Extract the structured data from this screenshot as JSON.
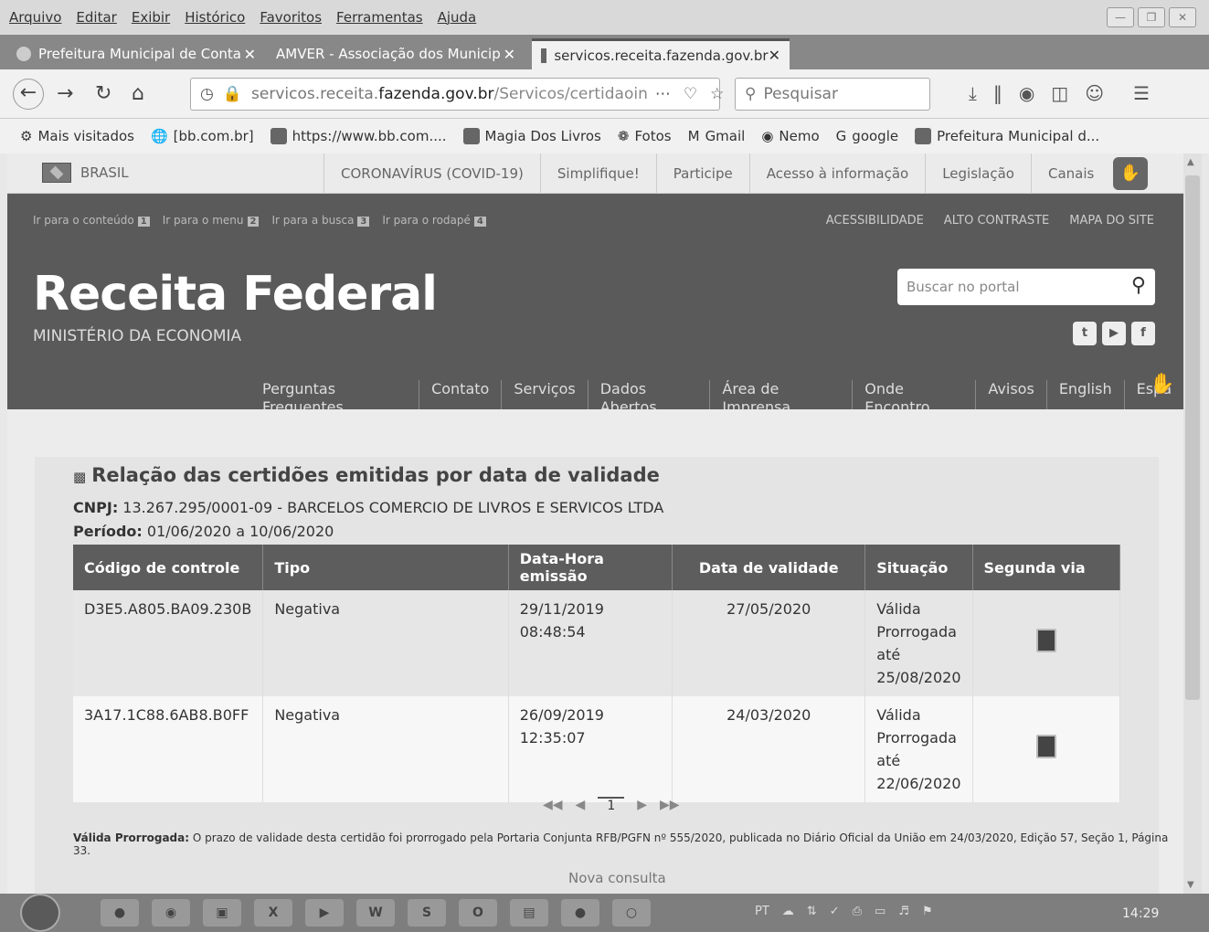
{
  "menubar": {
    "items": [
      "Arquivo",
      "Editar",
      "Exibir",
      "Histórico",
      "Favoritos",
      "Ferramentas",
      "Ajuda"
    ]
  },
  "tabs": [
    {
      "label": "Prefeitura Municipal de Conta",
      "active": false
    },
    {
      "label": "AMVER - Associação dos Municip",
      "active": false
    },
    {
      "label": "servicos.receita.fazenda.gov.br",
      "active": true
    }
  ],
  "url": {
    "prefix": "servicos.receita.",
    "domain": "fazenda.gov.br",
    "path": "/Servicos/certidaoin"
  },
  "search": {
    "placeholder": "Pesquisar"
  },
  "bookmarks": [
    "Mais visitados",
    "[bb.com.br]",
    "https://www.bb.com....",
    "Magia Dos Livros",
    "Fotos",
    "Gmail",
    "Nemo",
    "google",
    "Prefeitura Municipal d..."
  ],
  "govbar": {
    "brasil": "BRASIL",
    "links": [
      "CORONAVÍRUS (COVID-19)",
      "Simplifique!",
      "Participe",
      "Acesso à informação",
      "Legislação",
      "Canais"
    ]
  },
  "header": {
    "skip_links": [
      {
        "label": "Ir para o conteúdo",
        "key": "1"
      },
      {
        "label": "Ir para o menu",
        "key": "2"
      },
      {
        "label": "Ir para a busca",
        "key": "3"
      },
      {
        "label": "Ir para o rodapé",
        "key": "4"
      }
    ],
    "access_links": [
      "ACESSIBILIDADE",
      "ALTO CONTRASTE",
      "MAPA DO SITE"
    ],
    "title": "Receita Federal",
    "subtitle": "MINISTÉRIO DA ECONOMIA",
    "search_placeholder": "Buscar no portal",
    "nav": [
      "Perguntas Frequentes",
      "Contato",
      "Serviços",
      "Dados Abertos",
      "Área de Imprensa",
      "Onde Encontro",
      "Avisos",
      "English",
      "Espa"
    ]
  },
  "report": {
    "title": "Relação das certidões emitidas por data de validade",
    "cnpj_label": "CNPJ:",
    "cnpj_value": " 13.267.295/0001-09 - BARCELOS COMERCIO DE LIVROS E SERVICOS LTDA",
    "periodo_label": "Período:",
    "periodo_value": " 01/06/2020 a 10/06/2020",
    "columns": [
      "Código de controle",
      "Tipo",
      "Data-Hora emissão",
      "Data de validade",
      "Situação",
      "Segunda via"
    ],
    "rows": [
      {
        "codigo": "D3E5.A805.BA09.230B",
        "tipo": "Negativa",
        "emissao": "29/11/2019 08:48:54",
        "validade": "27/05/2020",
        "situacao": "Válida Prorrogada até 25/08/2020"
      },
      {
        "codigo": "3A17.1C88.6AB8.B0FF",
        "tipo": "Negativa",
        "emissao": "26/09/2019 12:35:07",
        "validade": "24/03/2020",
        "situacao": "Válida Prorrogada até 22/06/2020"
      }
    ],
    "page": "1",
    "footnote_label": "Válida Prorrogada:",
    "footnote_text": " O prazo de validade desta certidão foi prorrogado pela Portaria Conjunta RFB/PGFN nº 555/2020, publicada no Diário Oficial da União em 24/03/2020, Edição 57, Seção 1, Página 33.",
    "new_query": "Nova consulta"
  },
  "taskbar": {
    "lang": "PT",
    "time": "14:29"
  }
}
